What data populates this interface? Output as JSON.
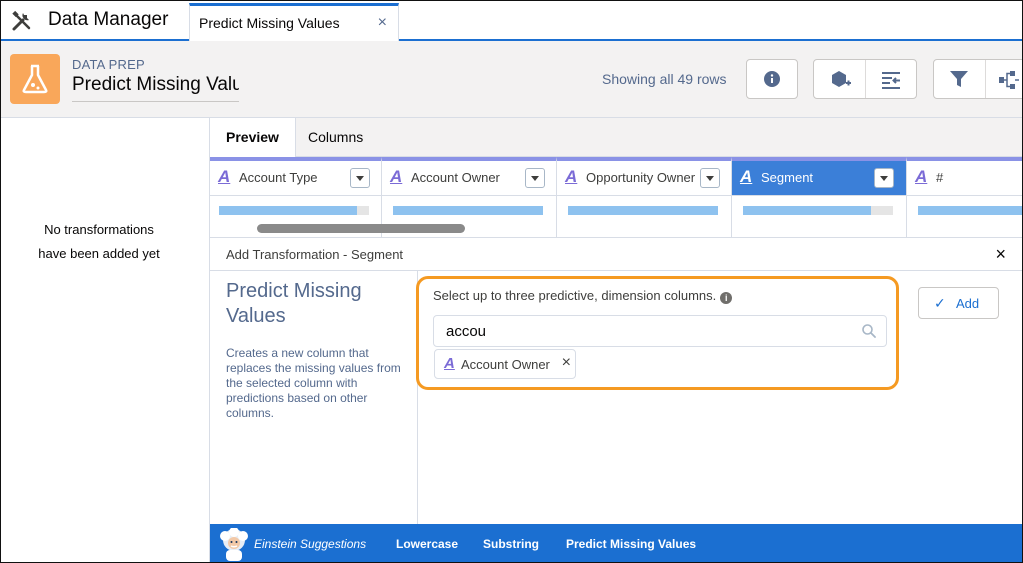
{
  "app": {
    "title": "Data Manager"
  },
  "tab": {
    "label": "Predict Missing Values",
    "close": "×"
  },
  "header": {
    "eyebrow": "DATA PREP",
    "recipe_name": "Predict Missing Valu",
    "row_count": "Showing all 49 rows"
  },
  "sidebar": {
    "empty_line1": "No transformations",
    "empty_line2": "have been added yet"
  },
  "subtabs": [
    {
      "label": "Preview",
      "active": true
    },
    {
      "label": "Columns",
      "active": false
    }
  ],
  "columns": [
    {
      "type_icon": "A",
      "name": "Account Type",
      "fill": 0.92
    },
    {
      "type_icon": "A",
      "name": "Account Owner",
      "fill": 1.0
    },
    {
      "type_icon": "A",
      "name": "Opportunity Owner",
      "fill": 1.0
    },
    {
      "type_icon": "A",
      "name": "Segment",
      "fill": 0.85,
      "selected": true
    },
    {
      "type_icon": "A",
      "name": "#",
      "fill": 1.0
    }
  ],
  "panel": {
    "title": "Add Transformation - Segment",
    "close": "×",
    "transform_name": "Predict Missing Values",
    "transform_desc": "Creates a new column that replaces the missing values from the selected column with predictions based on other columns.",
    "select_label": "Select up to three predictive, dimension columns.",
    "info": "i",
    "search_value": "accou",
    "selected_pill": {
      "type_icon": "A",
      "label": "Account Owner",
      "remove": "×"
    },
    "add_check": "✓",
    "add_label": "Add"
  },
  "suggestions": {
    "label": "Einstein Suggestions",
    "items": [
      "Lowercase",
      "Substring",
      "Predict Missing Values"
    ]
  },
  "colors": {
    "brand": "#1b6fd1",
    "highlight": "#f59a22",
    "recipe_icon": "#f9a75a"
  }
}
